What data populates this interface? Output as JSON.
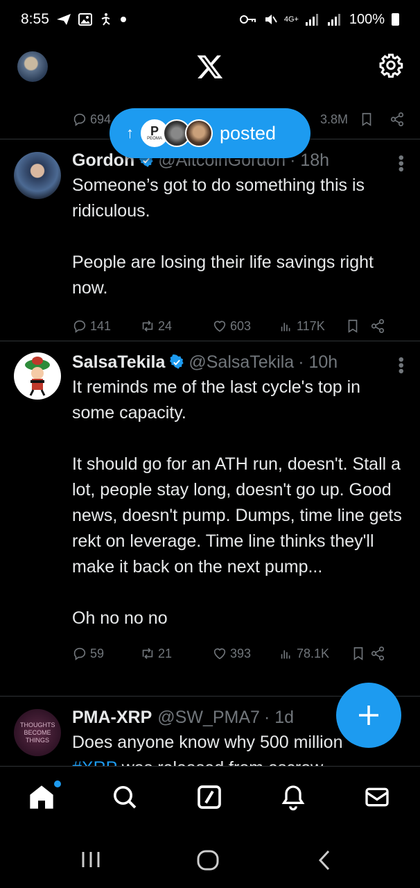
{
  "status_bar": {
    "time": "8:55",
    "left_icons": [
      "send-icon",
      "gallery-icon",
      "accessibility-icon",
      "dot-icon"
    ],
    "right_icons": [
      "vpn-key-icon",
      "mute-icon",
      "4g-icon",
      "signal-icon",
      "signal-r-icon"
    ],
    "network_label": "4G+",
    "battery": "100%"
  },
  "top_bar": {
    "logo": "x-logo-icon",
    "settings_icon": "gear-icon"
  },
  "top_tweet_actions": {
    "replies": "694",
    "views": "3.8M"
  },
  "new_posts_pill": {
    "label": "posted",
    "avatar_badge": "PEOMA"
  },
  "tweets": [
    {
      "name": "Gordon",
      "handle": "@AltcoinGordon",
      "time": "· 18h",
      "paragraphs": [
        "Someone’s got to do something this is ridiculous.",
        "People are losing their life savings right now."
      ],
      "replies": "141",
      "reposts": "24",
      "likes": "603",
      "views": "117K"
    },
    {
      "name": "SalsaTekila",
      "handle": "@SalsaTekila",
      "time": "· 10h",
      "paragraphs": [
        "It reminds me of the last cycle's top in some capacity.",
        "It should go for an ATH run, doesn't. Stall a lot, people stay long, doesn't go up. Good news, doesn't pump. Dumps, time line gets rekt on leverage. Time line thinks they'll make it back on the next pump...",
        "Oh no no no"
      ],
      "replies": "59",
      "reposts": "21",
      "likes": "393",
      "views": "78.1K"
    },
    {
      "name": "PMA-XRP",
      "handle": "@SW_PMA7",
      "time": "· 1d",
      "avatar_text": "THOUGHTS BECOME THINGS",
      "text_line1": "Does anyone know why 500 million",
      "text_tag": "#XRP",
      "text_line2_rest": " was released from escrow"
    }
  ],
  "bottom_nav": [
    "home-icon",
    "search-icon",
    "grok-icon",
    "notifications-icon",
    "messages-icon"
  ],
  "system_nav": [
    "recents-icon",
    "home-circle-icon",
    "back-icon"
  ],
  "colors": {
    "accent": "#1d9bf0",
    "background": "#000000",
    "text": "#e7e9ea",
    "muted": "#71767b",
    "divider": "#2f3336"
  }
}
